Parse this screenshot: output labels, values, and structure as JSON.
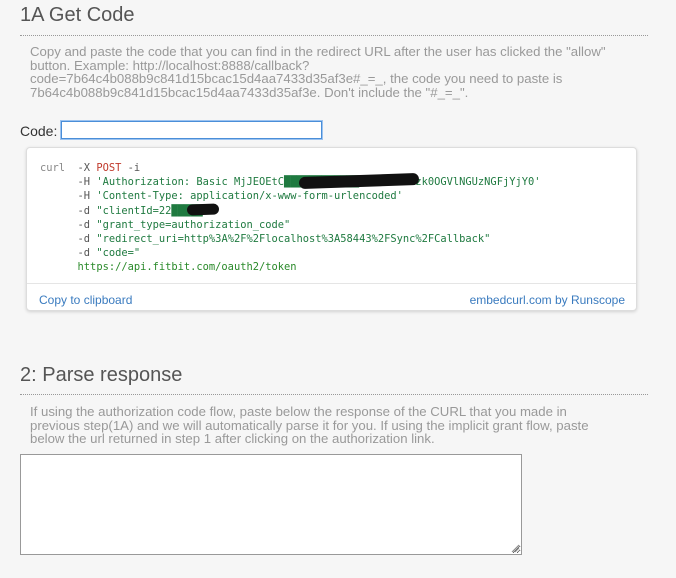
{
  "step1": {
    "title": "1A Get Code",
    "description": "Copy and paste the code that you can find in the redirect URL after the user has clicked the \"allow\" button. Example: http://localhost:8888/callback?code=7b64c4b088b9c841d15bcac15d4aa7433d35af3e#_=_, the code you need to paste is 7b64c4b088b9c841d15bcac15d4aa7433d35af3e. Don't include the \"#_=_\".",
    "code_label": "Code:",
    "code_value": ""
  },
  "curl": {
    "lines": [
      {
        "cmd": "curl",
        "flag": "-X",
        "method": "POST",
        "rest": " -i"
      },
      {
        "flag": "-H",
        "str": "'Authorization: Basic MjJEOEtC████████████NGFlMDhiMzk0OGVlNGUzNGFjYjY0'"
      },
      {
        "flag": "-H",
        "str": "'Content-Type: application/x-www-form-urlencoded'"
      },
      {
        "flag": "-d",
        "str": "\"clientId=22█████\""
      },
      {
        "flag": "-d",
        "str": "\"grant_type=authorization_code\""
      },
      {
        "flag": "-d",
        "str": "\"redirect_uri=http%3A%2F%2Flocalhost%3A58443%2FSync%2FCallback\""
      },
      {
        "flag": "-d",
        "str": "\"code=\""
      },
      {
        "url": "https://api.fitbit.com/oauth2/token"
      }
    ],
    "copy_label": "Copy to clipboard",
    "brand_label": "embedcurl.com by Runscope"
  },
  "step2": {
    "title": "2: Parse response",
    "description": "If using the authorization code flow, paste below the response of the CURL that you made in previous step(1A) and we will automatically parse it for you. If using the implicit grant flow, paste below the url returned in step 1 after clicking on the authorization link.",
    "response_value": ""
  },
  "colors": {
    "background": "#f6f6f6",
    "link": "#3a7bbf",
    "http_method": "#c0392b",
    "string": "#1f7a40",
    "input_focus": "#4a8ed8"
  },
  "icons": {
    "textarea_grip": "resize-grip-icon"
  }
}
